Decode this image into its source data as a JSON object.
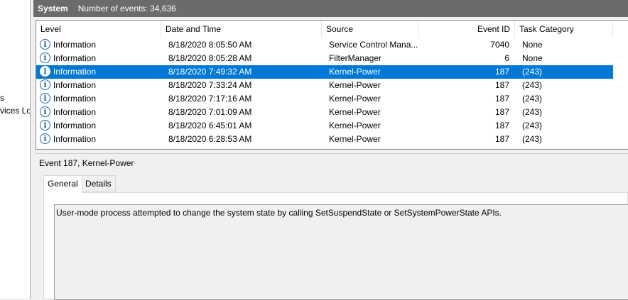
{
  "left_pane": {
    "lines": [
      "s",
      "vices Lo"
    ]
  },
  "header": {
    "title": "System",
    "count_text": "Number of events: 34,636"
  },
  "columns": [
    {
      "label": "Level"
    },
    {
      "label": "Date and Time"
    },
    {
      "label": "Source"
    },
    {
      "label": "Event ID"
    },
    {
      "label": "Task Category"
    }
  ],
  "rows": [
    {
      "level": "Information",
      "datetime": "8/18/2020 8:05:50 AM",
      "source": "Service Control Mana...",
      "event_id": "7040",
      "category": "None"
    },
    {
      "level": "Information",
      "datetime": "8/18/2020 8:05:28 AM",
      "source": "FilterManager",
      "event_id": "6",
      "category": "None"
    },
    {
      "level": "Information",
      "datetime": "8/18/2020 7:49:32 AM",
      "source": "Kernel-Power",
      "event_id": "187",
      "category": "(243)",
      "selected": true
    },
    {
      "level": "Information",
      "datetime": "8/18/2020 7:33:24 AM",
      "source": "Kernel-Power",
      "event_id": "187",
      "category": "(243)"
    },
    {
      "level": "Information",
      "datetime": "8/18/2020 7:17:16 AM",
      "source": "Kernel-Power",
      "event_id": "187",
      "category": "(243)"
    },
    {
      "level": "Information",
      "datetime": "8/18/2020 7:01:09 AM",
      "source": "Kernel-Power",
      "event_id": "187",
      "category": "(243)"
    },
    {
      "level": "Information",
      "datetime": "8/18/2020 6:45:01 AM",
      "source": "Kernel-Power",
      "event_id": "187",
      "category": "(243)"
    },
    {
      "level": "Information",
      "datetime": "8/18/2020 6:28:53 AM",
      "source": "Kernel-Power",
      "event_id": "187",
      "category": "(243)"
    }
  ],
  "detail": {
    "title": "Event 187, Kernel-Power",
    "tabs": [
      {
        "label": "General"
      },
      {
        "label": "Details"
      }
    ],
    "description": "User-mode process attempted to change the system state by calling SetSuspendState or SetSystemPowerState APIs."
  },
  "icons": {
    "row_level": "information-icon"
  },
  "colors": {
    "selection": "#0078d7",
    "header_bar": "#6b6b6b"
  }
}
